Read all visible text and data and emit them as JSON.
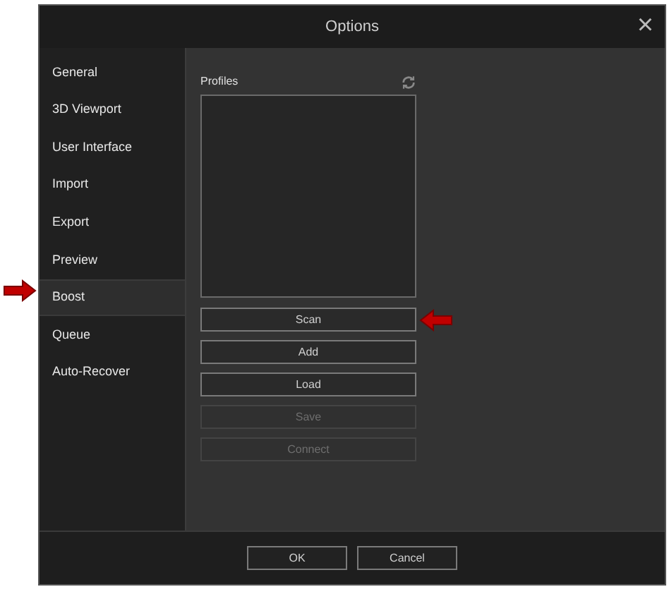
{
  "window": {
    "title": "Options",
    "close": "×"
  },
  "sidebar": {
    "items": [
      {
        "label": "General",
        "selected": false
      },
      {
        "label": "3D Viewport",
        "selected": false
      },
      {
        "label": "User Interface",
        "selected": false
      },
      {
        "label": "Import",
        "selected": false
      },
      {
        "label": "Export",
        "selected": false
      },
      {
        "label": "Preview",
        "selected": false
      },
      {
        "label": "Boost",
        "selected": true
      },
      {
        "label": "Queue",
        "selected": false
      },
      {
        "label": "Auto-Recover",
        "selected": false
      }
    ]
  },
  "profiles": {
    "label": "Profiles",
    "buttons": [
      {
        "label": "Scan",
        "disabled": false
      },
      {
        "label": "Add",
        "disabled": false
      },
      {
        "label": "Load",
        "disabled": false
      },
      {
        "label": "Save",
        "disabled": true
      },
      {
        "label": "Connect",
        "disabled": true
      }
    ]
  },
  "footer": {
    "buttons": [
      "OK",
      "Cancel"
    ]
  }
}
